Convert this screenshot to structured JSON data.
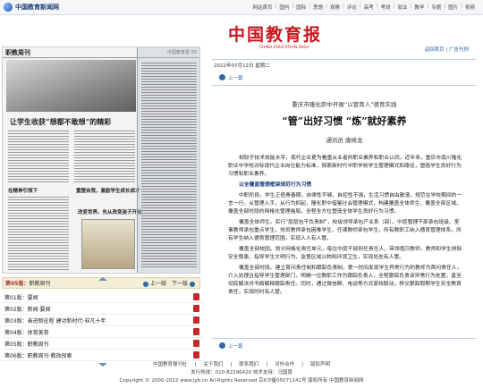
{
  "site": {
    "name": "中国教育新闻网"
  },
  "nav": [
    "网站首页",
    "国内",
    "国际",
    "思想",
    "观察",
    "评论",
    "高考",
    "考研",
    "就业",
    "教学",
    "专题",
    "图片",
    "视频"
  ],
  "paper": {
    "masthead": "职教周刊",
    "page_ref": "中国教育报 05",
    "headline": "让学生收获“想都不敢想”的精彩",
    "sub1": "在精神引领下",
    "sub2": "重塑自我，激励学生成长成才",
    "sub3": "改变世界，先从改变孩子开始"
  },
  "pagebar": {
    "version": "第05版：",
    "name": "职教周刊",
    "prev": "上一版",
    "next": "下一版"
  },
  "toc": [
    {
      "label": "第01版：要闻"
    },
    {
      "label": "第02版：新闻·要闻"
    },
    {
      "label": "第03版：奋进新征程 建功新时代·非凡十年"
    },
    {
      "label": "第04版：体育美育"
    },
    {
      "label": "第05版：职教周刊"
    },
    {
      "label": "第06版：职教周刊·教改探索"
    }
  ],
  "brand": {
    "name": "中国教育报",
    "en": "CHINA EDUCATION DAILY"
  },
  "links": {
    "back": "返回首页",
    "ad": "广告刊例"
  },
  "date": "2022年07月12日 星期二",
  "article_nav": {
    "prev": "上一篇",
    "next": "上一篇"
  },
  "article": {
    "subtitle": "重庆市隆化职中开展“以管育人”德育实践",
    "title": "“管”出好习惯 “炼”就好素养",
    "author": "通讯员 唐绮龙",
    "paragraphs": [
      {
        "type": "p",
        "text": "相较于技术技能水平，现代企业更为看重从业者的职业素养和职业认同。近年来，重庆市南川隆化职业中学校对标现代企业岗位能力标准，探索新时代中职学校学生管理模式和路径，塑造学生良好行为习惯和职业素养。"
      },
      {
        "type": "h",
        "text": "以全覆盖管理框架规范行为习惯"
      },
      {
        "type": "p",
        "text": "中职阶段，学生正值青春期，自律性不够、自控性不强，生活习惯自由散漫，规范在学校期间的一言一行，从管理入手，从行为抓起，隆化职中借鉴社会管理模式，构建覆盖全体师生、覆盖全部区域、覆盖全部时段的网格化管理格局，全程全方位塑造全体学生良好行为习惯。"
      },
      {
        "type": "p",
        "text": "覆盖全体师生。实行“层层包干负责制”，校级领导承包产业系（部）、中层管理干部承包班级、室事教师承包重点学生，党员教师承包困难学生、任课教师承包学生，所有教职工纳入德育管理体系，所有学生纳入德育管理范围，实现人人有人管。"
      },
      {
        "type": "p",
        "text": "覆盖全部校园。划分网格化责任单元，每位中层干部担任责任人，带领值日教师、教师和学生排除安全隐患、指导学生文明行为、监督区域公物和环境卫生，实现处处有人管。"
      },
      {
        "type": "p",
        "text": "覆盖全部时段。建立首问责任制和跟踪负责制，第一时间发现学生异常行为的教师为首问责任人，介入处理且指导学生管理部门，明确一位教职工作为跟踪负责人，全程跟踪负责该异常行为处置，直至彻底解决并书面解释跟踪责任。同时，通过微信群、电话等方式家校联动，移交跟踪假期学生安全教育责任，实现时时有人管。"
      }
    ]
  },
  "footer": {
    "links": [
      "中国教育报刊社",
      "关于我们",
      "联系我们",
      "对外合作",
      "版权声明"
    ],
    "line2": "发行热线：010-82296420 技术支持：马国喜",
    "line3": "Copyright © 2000-2022 www.jyb.cn All Rights Reserved 京ICP备05071141号 版权所有 中国教育新闻网"
  }
}
